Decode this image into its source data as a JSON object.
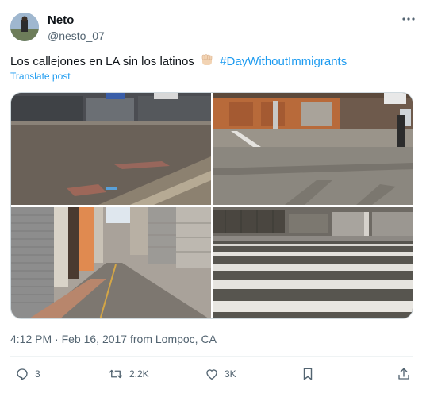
{
  "author": {
    "name": "Neto",
    "handle": "@nesto_07"
  },
  "tweet": {
    "text": "Los callejones en LA sin los latinos",
    "emoji": "raised-fist-light-skin-tone",
    "hashtag": "#DayWithoutImmigrants",
    "translate_label": "Translate post"
  },
  "media": {
    "photos": [
      "photo-empty-street-day",
      "photo-closed-storefronts-corner",
      "photo-empty-alley-shutters",
      "photo-empty-crosswalk"
    ]
  },
  "meta": {
    "timestamp": "4:12 PM · Feb 16, 2017 from Lompoc, CA"
  },
  "actions": {
    "replies": "3",
    "reposts": "2.2K",
    "likes": "3K"
  },
  "colors": {
    "accent": "#1d9bf0",
    "muted": "#536471",
    "text": "#0f1419"
  }
}
